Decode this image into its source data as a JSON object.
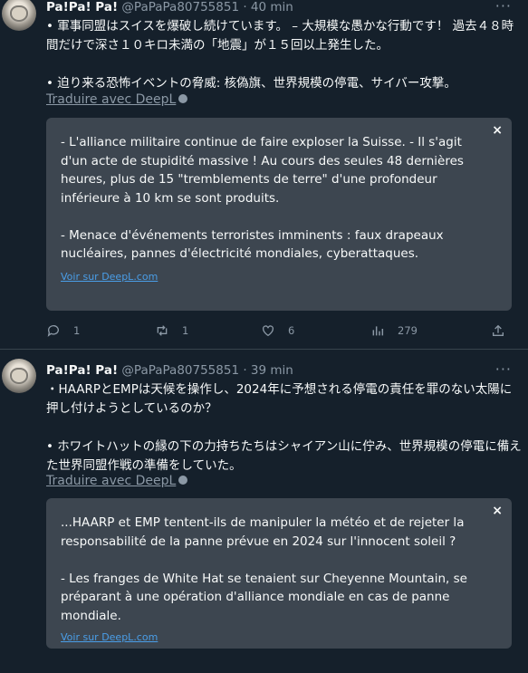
{
  "tweets": [
    {
      "name": "Pa!Pa! Pa!",
      "handle": "@PaPaPa80755851",
      "time": "· 40 min",
      "text": "• 軍事同盟はスイスを爆破し続けています。 – 大規模な愚かな行動です！ 過去４８時間だけで深さ１０キロ未満の「地震」が１５回以上発生した。\n\n• 迫り来る恐怖イベントの脅威: 核偽旗、世界規模の停電、サイバー攻撃。",
      "translate_label": "Traduire avec DeepL",
      "translation": "- L'alliance militaire continue de faire exploser la Suisse. - Il s'agit d'un acte de stupidité massive ! Au cours des seules 48 dernières heures, plus de 15 \"tremblements de terre\" d'une profondeur inférieure à 10 km se sont produits.\n\n- Menace d'événements terroristes imminents : faux drapeaux nucléaires, pannes d'électricité mondiales, cyberattaques.",
      "close": "×",
      "deepl_link": "Voir sur DeepL.com",
      "replies": "1",
      "retweets": "1",
      "likes": "6",
      "views": "279"
    },
    {
      "name": "Pa!Pa! Pa!",
      "handle": "@PaPaPa80755851",
      "time": "· 39 min",
      "text": "・HAARPとEMPは天候を操作し、2024年に予想される停電の責任を罪のない太陽に押し付けようとしているのか？\n\n• ホワイトハットの縁の下の力持ちたちはシャイアン山に佇み、世界規模の停電に備えた世界同盟作戦の準備をしていた。",
      "translate_label": "Traduire avec DeepL",
      "translation": "...HAARP et EMP tentent-ils de manipuler la météo et de rejeter la responsabilité de la panne prévue en 2024 sur l'innocent soleil ?\n\n- Les franges de White Hat se tenaient sur Cheyenne Mountain, se préparant à une opération d'alliance mondiale en cas de panne mondiale.",
      "close": "×",
      "deepl_link": "Voir sur DeepL.com"
    }
  ],
  "more_glyph": "···"
}
